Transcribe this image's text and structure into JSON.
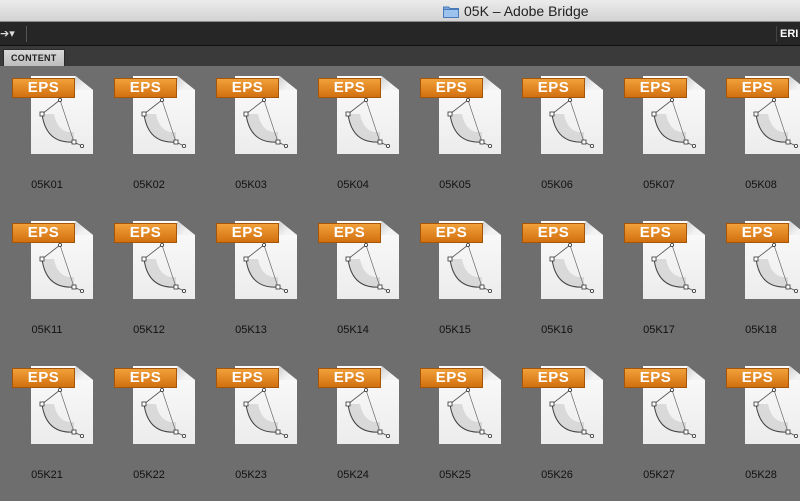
{
  "window": {
    "title": "05K – Adobe Bridge"
  },
  "toolbar": {
    "nav_symbol": "➔▾",
    "workspace_label": "ERI"
  },
  "tabs": [
    {
      "label": "CONTENT"
    }
  ],
  "badge_text": "EPS",
  "colors": {
    "badge": "#e0821f",
    "background": "#6e6e6e",
    "toolbar": "#262626"
  },
  "files": [
    {
      "name": "05K01"
    },
    {
      "name": "05K02"
    },
    {
      "name": "05K03"
    },
    {
      "name": "05K04"
    },
    {
      "name": "05K05"
    },
    {
      "name": "05K06"
    },
    {
      "name": "05K07"
    },
    {
      "name": "05K08"
    },
    {
      "name": "05K11"
    },
    {
      "name": "05K12"
    },
    {
      "name": "05K13"
    },
    {
      "name": "05K14"
    },
    {
      "name": "05K15"
    },
    {
      "name": "05K16"
    },
    {
      "name": "05K17"
    },
    {
      "name": "05K18"
    },
    {
      "name": "05K21"
    },
    {
      "name": "05K22"
    },
    {
      "name": "05K23"
    },
    {
      "name": "05K24"
    },
    {
      "name": "05K25"
    },
    {
      "name": "05K26"
    },
    {
      "name": "05K27"
    },
    {
      "name": "05K28"
    }
  ]
}
